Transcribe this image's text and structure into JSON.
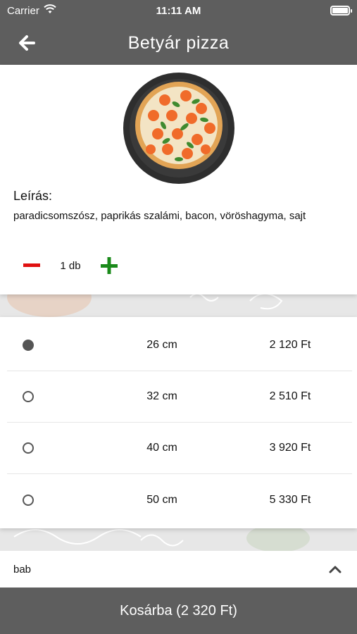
{
  "status_bar": {
    "carrier": "Carrier",
    "time": "11:11 AM",
    "icons": [
      "wifi-icon",
      "battery-icon"
    ]
  },
  "nav": {
    "title": "Betyár pizza",
    "back_icon": "arrow-left-icon"
  },
  "product": {
    "image_icon": "pizza-image",
    "description_label": "Leírás:",
    "description": "paradicsomszósz, paprikás szalámi, bacon, vöröshagyma, sajt",
    "quantity": "1 db",
    "minus_icon": "minus-icon",
    "plus_icon": "plus-icon",
    "minus_color": "#e01010",
    "plus_color": "#1a8a1a"
  },
  "sizes": [
    {
      "label": "26 cm",
      "price": "2 120 Ft",
      "selected": true
    },
    {
      "label": "32 cm",
      "price": "2 510 Ft",
      "selected": false
    },
    {
      "label": "40 cm",
      "price": "3 920 Ft",
      "selected": false
    },
    {
      "label": "50 cm",
      "price": "5 330 Ft",
      "selected": false
    }
  ],
  "extra": {
    "label": "bab",
    "icon": "chevron-up-icon"
  },
  "cart": {
    "label": "Kosárba (2 320 Ft)"
  },
  "colors": {
    "bar": "#5e5e5e",
    "background": "#e7e7e7"
  }
}
